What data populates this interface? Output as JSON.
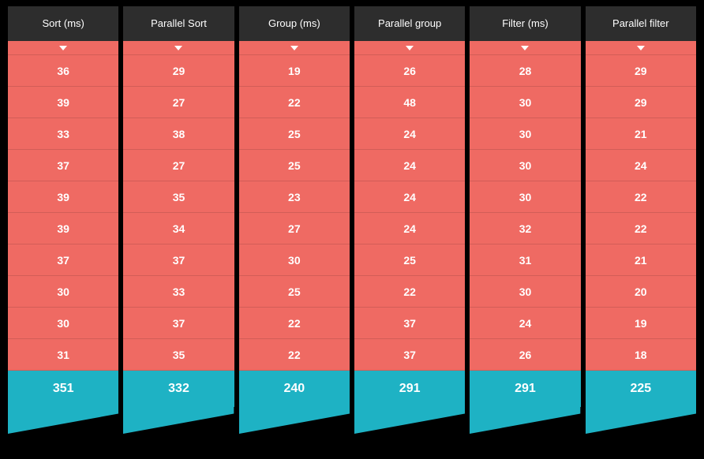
{
  "columns": [
    {
      "label": "Sort  (ms)",
      "values": [
        36,
        39,
        33,
        37,
        39,
        39,
        37,
        30,
        30,
        31
      ],
      "total": 351
    },
    {
      "label": "Parallel Sort",
      "values": [
        29,
        27,
        38,
        27,
        35,
        34,
        37,
        33,
        37,
        35
      ],
      "total": 332
    },
    {
      "label": "Group  (ms)",
      "values": [
        19,
        22,
        25,
        25,
        23,
        27,
        30,
        25,
        22,
        22
      ],
      "total": 240
    },
    {
      "label": "Parallel group",
      "values": [
        26,
        48,
        24,
        24,
        24,
        24,
        25,
        22,
        37,
        37
      ],
      "total": 291
    },
    {
      "label": "Filter (ms)",
      "values": [
        28,
        30,
        30,
        30,
        30,
        32,
        31,
        30,
        24,
        26
      ],
      "total": 291
    },
    {
      "label": "Parallel filter",
      "values": [
        29,
        29,
        21,
        24,
        22,
        22,
        21,
        20,
        19,
        18
      ],
      "total": 225
    }
  ],
  "chart_data": {
    "type": "table",
    "title": "",
    "columns": [
      "Sort  (ms)",
      "Parallel Sort",
      "Group  (ms)",
      "Parallel group",
      "Filter (ms)",
      "Parallel filter"
    ],
    "rows": [
      [
        36,
        29,
        19,
        26,
        28,
        29
      ],
      [
        39,
        27,
        22,
        48,
        30,
        29
      ],
      [
        33,
        38,
        25,
        24,
        30,
        21
      ],
      [
        37,
        27,
        25,
        24,
        30,
        24
      ],
      [
        39,
        35,
        23,
        24,
        30,
        22
      ],
      [
        39,
        34,
        27,
        24,
        32,
        22
      ],
      [
        37,
        37,
        30,
        25,
        31,
        21
      ],
      [
        30,
        33,
        25,
        22,
        30,
        20
      ],
      [
        30,
        37,
        22,
        37,
        24,
        19
      ],
      [
        31,
        35,
        22,
        37,
        26,
        18
      ]
    ],
    "totals": [
      351,
      332,
      240,
      291,
      291,
      225
    ]
  }
}
